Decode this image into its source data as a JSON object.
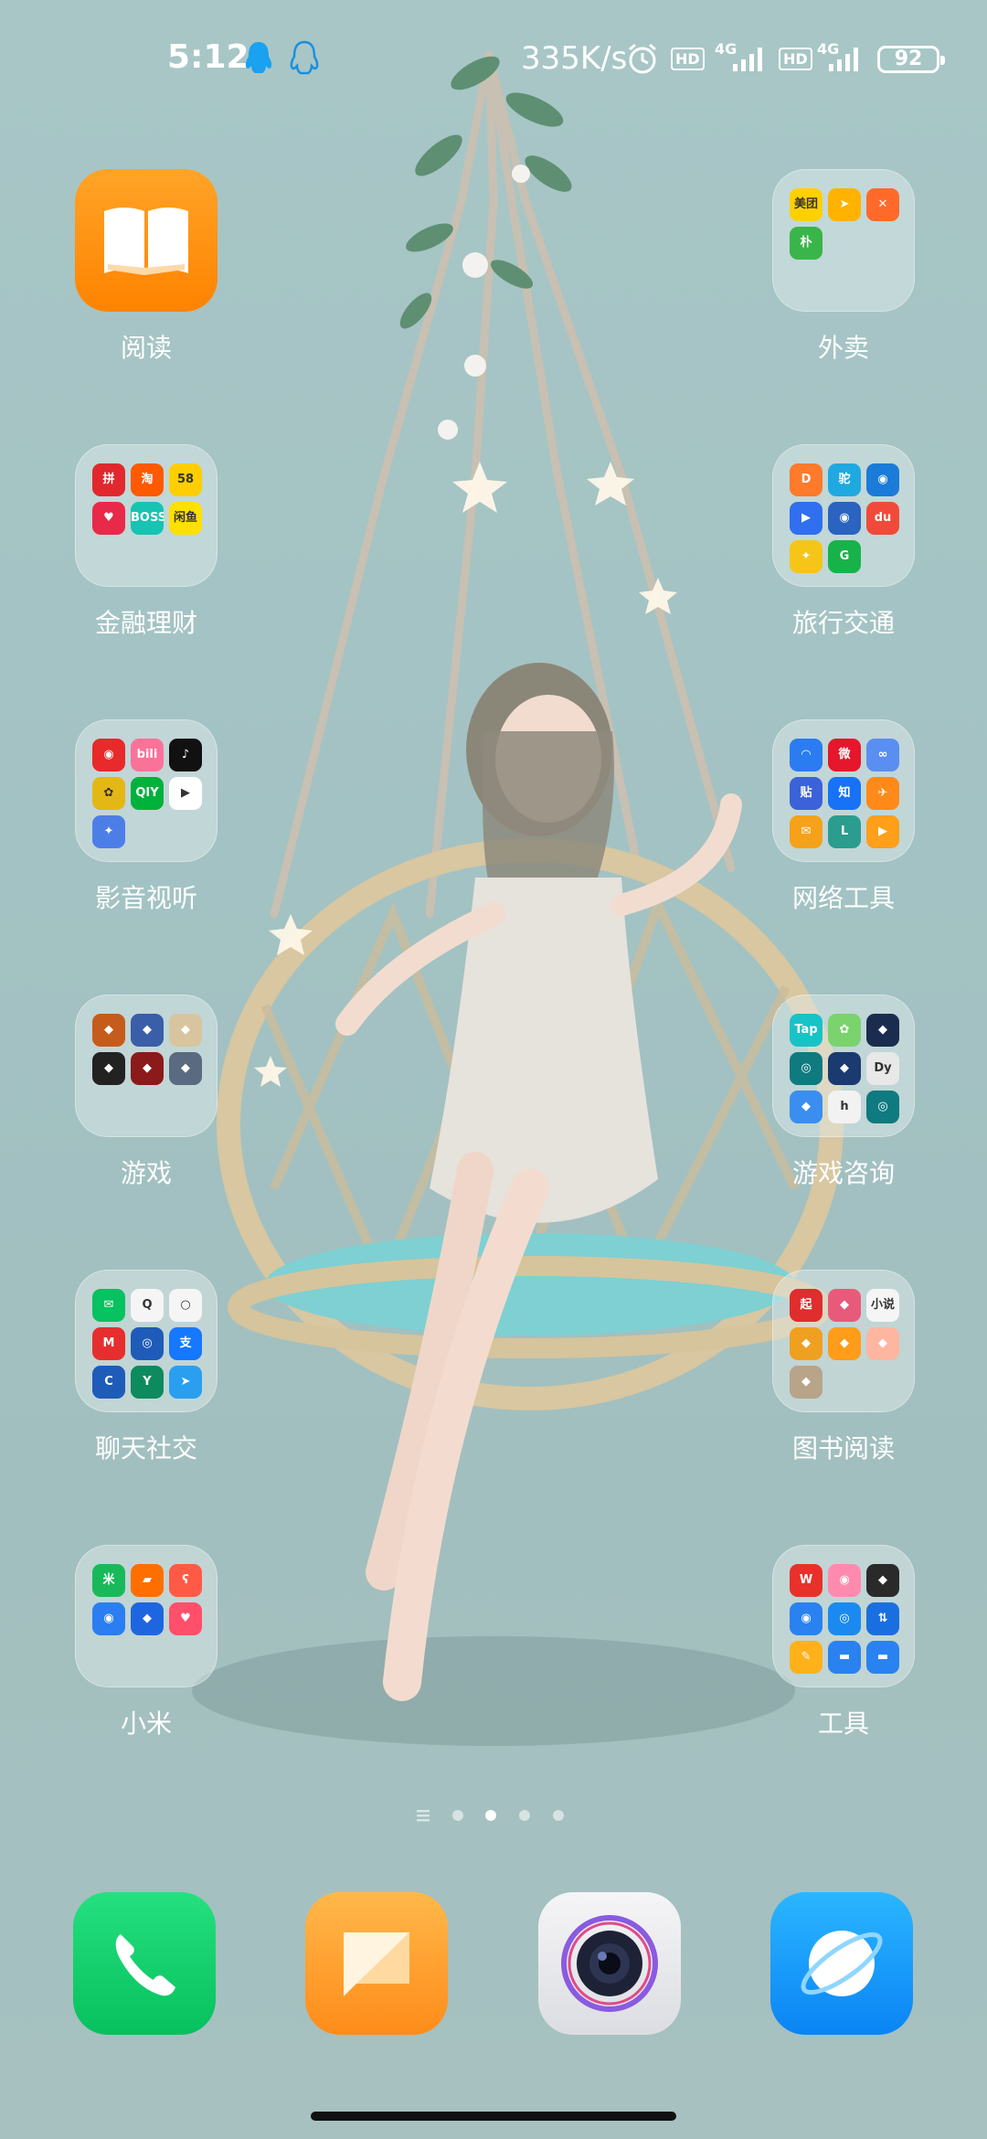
{
  "status_bar": {
    "time": "5:12",
    "net_speed": "335K/s",
    "sim1_type": "4G",
    "sim2_type": "4G",
    "hd1": "HD",
    "hd2": "HD",
    "battery_level": "92",
    "icons": [
      "qq-icon",
      "qq-icon",
      "alarm-icon",
      "hd-icon",
      "signal-icon",
      "hd-icon",
      "signal-icon",
      "battery-icon"
    ]
  },
  "desktop": {
    "left_column": [
      {
        "label": "阅读",
        "type": "app",
        "icon": "book-icon"
      },
      {
        "label": "金融理财",
        "type": "folder",
        "minis": [
          {
            "t": "拼",
            "c": "#e0282e"
          },
          {
            "t": "淘",
            "c": "#ff5a00"
          },
          {
            "t": "58",
            "c": "#ffce00"
          },
          {
            "t": "♥",
            "c": "#e8294a"
          },
          {
            "t": "BOSS",
            "c": "#17c3b2"
          },
          {
            "t": "闲鱼",
            "c": "#ffe000"
          }
        ]
      },
      {
        "label": "影音视听",
        "type": "folder",
        "minis": [
          {
            "t": "◉",
            "c": "#e82a2a"
          },
          {
            "t": "bili",
            "c": "#fb7299"
          },
          {
            "t": "♪",
            "c": "#111111"
          },
          {
            "t": "✿",
            "c": "#e4b814"
          },
          {
            "t": "QIY",
            "c": "#00b13b"
          },
          {
            "t": "▶",
            "c": "#ffffff"
          },
          {
            "t": "✦",
            "c": "#4d7ee8"
          }
        ]
      },
      {
        "label": "游戏",
        "type": "folder",
        "minis": [
          {
            "t": "◆",
            "c": "#c55c1c"
          },
          {
            "t": "◆",
            "c": "#3a5fa8"
          },
          {
            "t": "◆",
            "c": "#d8c5a0"
          },
          {
            "t": "◆",
            "c": "#222222"
          },
          {
            "t": "◆",
            "c": "#8b1a1a"
          },
          {
            "t": "◆",
            "c": "#5a6a80"
          }
        ]
      },
      {
        "label": "聊天社交",
        "type": "folder",
        "minis": [
          {
            "t": "✉",
            "c": "#08c160"
          },
          {
            "t": "Q",
            "c": "#f5f5f5"
          },
          {
            "t": "○",
            "c": "#f5f5f5"
          },
          {
            "t": "M",
            "c": "#e62e2e"
          },
          {
            "t": "◎",
            "c": "#1f5bb8"
          },
          {
            "t": "支",
            "c": "#1677ff"
          },
          {
            "t": "C",
            "c": "#1f5bb8"
          },
          {
            "t": "Y",
            "c": "#0e8a5f"
          },
          {
            "t": "➤",
            "c": "#2a9ff0"
          }
        ]
      },
      {
        "label": "小米",
        "type": "folder",
        "minis": [
          {
            "t": "米",
            "c": "#19b95a"
          },
          {
            "t": "▰",
            "c": "#ff6f00"
          },
          {
            "t": "ʕ",
            "c": "#ff5a45"
          },
          {
            "t": "◉",
            "c": "#2a7ef2"
          },
          {
            "t": "◆",
            "c": "#1e66e0"
          },
          {
            "t": "♥",
            "c": "#ff4f6a"
          }
        ]
      }
    ],
    "right_column": [
      {
        "label": "外卖",
        "type": "folder",
        "minis": [
          {
            "t": "美团",
            "c": "#ffd000"
          },
          {
            "t": "➤",
            "c": "#ffb300"
          },
          {
            "t": "✕",
            "c": "#ff6a2a"
          },
          {
            "t": "朴",
            "c": "#3ab54a"
          }
        ]
      },
      {
        "label": "旅行交通",
        "type": "folder",
        "minis": [
          {
            "t": "D",
            "c": "#ff7a2a"
          },
          {
            "t": "驼",
            "c": "#20a9e0"
          },
          {
            "t": "◉",
            "c": "#1a7bd8"
          },
          {
            "t": "▶",
            "c": "#2f6ff0"
          },
          {
            "t": "◉",
            "c": "#2a63c0"
          },
          {
            "t": "du",
            "c": "#f24a3a"
          },
          {
            "t": "✦",
            "c": "#f5c518"
          },
          {
            "t": "G",
            "c": "#17b34a"
          }
        ]
      },
      {
        "label": "网络工具",
        "type": "folder",
        "minis": [
          {
            "t": "◠",
            "c": "#2a7cf0"
          },
          {
            "t": "微",
            "c": "#e6162d"
          },
          {
            "t": "∞",
            "c": "#5a8ef0"
          },
          {
            "t": "贴",
            "c": "#3b62d8"
          },
          {
            "t": "知",
            "c": "#1772f6"
          },
          {
            "t": "✈",
            "c": "#ff8a1a"
          },
          {
            "t": "✉",
            "c": "#f5a21a"
          },
          {
            "t": "L",
            "c": "#2a9d8f"
          },
          {
            "t": "▶",
            "c": "#ff9f1a"
          }
        ]
      },
      {
        "label": "游戏咨询",
        "type": "folder",
        "minis": [
          {
            "t": "Tap",
            "c": "#18c3c7"
          },
          {
            "t": "✿",
            "c": "#7ad36c"
          },
          {
            "t": "◆",
            "c": "#1b2d4f"
          },
          {
            "t": "◎",
            "c": "#0f7a80"
          },
          {
            "t": "◆",
            "c": "#1a3a70"
          },
          {
            "t": "Dy",
            "c": "#e8e8e8"
          },
          {
            "t": "◆",
            "c": "#3a8ef0"
          },
          {
            "t": "h",
            "c": "#f2f2f2"
          },
          {
            "t": "◎",
            "c": "#0f7a80"
          }
        ]
      },
      {
        "label": "图书阅读",
        "type": "folder",
        "minis": [
          {
            "t": "起",
            "c": "#e02d2d"
          },
          {
            "t": "◆",
            "c": "#e85a7a"
          },
          {
            "t": "小说",
            "c": "#f5f5f5"
          },
          {
            "t": "◆",
            "c": "#f0a020"
          },
          {
            "t": "◆",
            "c": "#ff9c1a"
          },
          {
            "t": "◆",
            "c": "#ffb6a0"
          },
          {
            "t": "◆",
            "c": "#b8a488"
          }
        ]
      },
      {
        "label": "工具",
        "type": "folder",
        "minis": [
          {
            "t": "W",
            "c": "#e8312a"
          },
          {
            "t": "◉",
            "c": "#ff8ab0"
          },
          {
            "t": "◆",
            "c": "#2a2a2a"
          },
          {
            "t": "◉",
            "c": "#2a82f0"
          },
          {
            "t": "◎",
            "c": "#1a8af0"
          },
          {
            "t": "⇅",
            "c": "#1a6fe0"
          },
          {
            "t": "✎",
            "c": "#ffb11a"
          },
          {
            "t": "▬",
            "c": "#2a82f0"
          },
          {
            "t": "▬",
            "c": "#2a82f0"
          }
        ]
      }
    ]
  },
  "page_indicator": {
    "pages": 4,
    "active_index": 1,
    "has_list_icon": true
  },
  "dock": [
    {
      "name": "phone",
      "icon": "phone-icon",
      "color": "#0fcf6b"
    },
    {
      "name": "messages",
      "icon": "message-icon",
      "color": "#ff9a2a"
    },
    {
      "name": "camera",
      "icon": "camera-icon",
      "color": "#e8e8ea"
    },
    {
      "name": "browser",
      "icon": "browser-icon",
      "color": "#1aa0ff"
    }
  ]
}
